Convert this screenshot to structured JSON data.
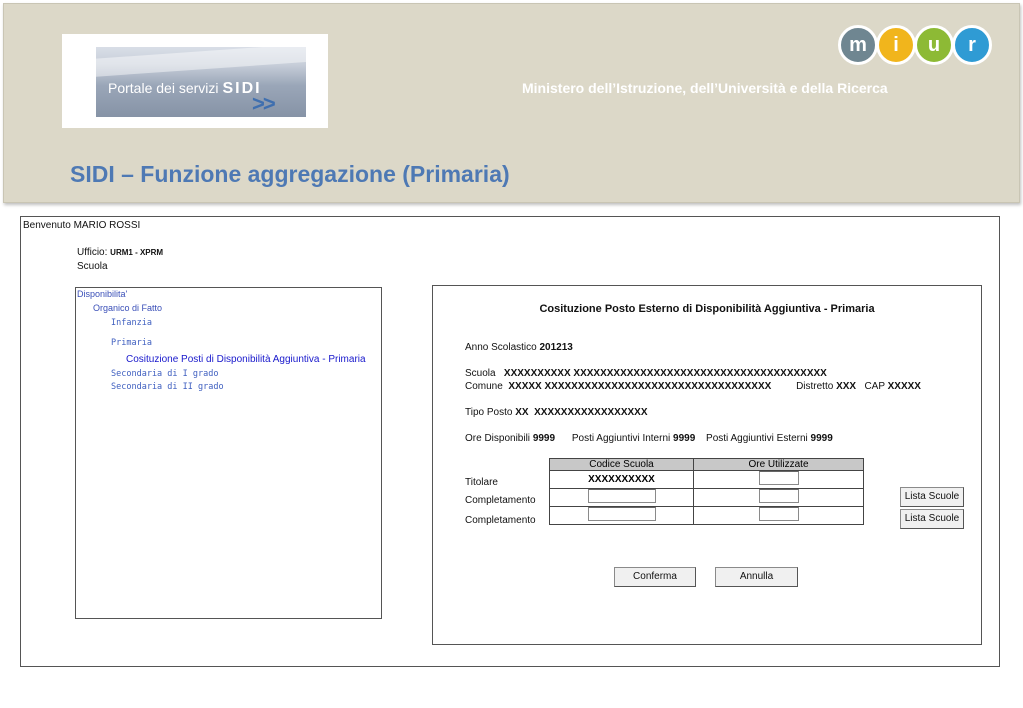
{
  "header": {
    "logo": {
      "text": "Portale dei servizi",
      "brand": "SIDI",
      "arrows": ">>"
    },
    "miur_letters": [
      "m",
      "i",
      "u",
      "r"
    ],
    "miur_colors": [
      "#6f8691",
      "#f1b51c",
      "#8dba35",
      "#2f9bd4"
    ],
    "ministry": "Ministero dell’Istruzione, dell’Università e della Ricerca",
    "title": "SIDI – Funzione aggregazione (Primaria)"
  },
  "user": {
    "welcome": "Benvenuto MARIO ROSSI",
    "ufficio_label": "Ufficio:",
    "ufficio_value": "URM1 - XPRM",
    "scuola_label": "Scuola"
  },
  "tree": {
    "disponibilita": "Disponibilita'",
    "organico": "Organico di Fatto",
    "infanzia": "Infanzia",
    "primaria": "Primaria",
    "costituzione": "Cosituzione Posti di Disponibilità Aggiuntiva - Primaria",
    "sec1": "Secondaria di I grado",
    "sec2": "Secondaria di II grado"
  },
  "panel": {
    "title": "Cosituzione Posto Esterno di Disponibilità Aggiuntiva - Primaria",
    "anno_label": "Anno Scolastico",
    "anno_value": "201213",
    "scuola_label": "Scuola",
    "scuola_value": "XXXXXXXXXX XXXXXXXXXXXXXXXXXXXXXXXXXXXXXXXXXXXXXX",
    "comune_label": "Comune",
    "comune_value": "XXXXX XXXXXXXXXXXXXXXXXXXXXXXXXXXXXXXXXX",
    "distretto_label": "Distretto",
    "distretto_value": "XXX",
    "cap_label": "CAP",
    "cap_value": "XXXXX",
    "tipo_label": "Tipo Posto",
    "tipo_code": "XX",
    "tipo_value": "XXXXXXXXXXXXXXXXX",
    "ore_label": "Ore Disponibili",
    "ore_value": "9999",
    "interni_label": "Posti Aggiuntivi Interni",
    "interni_value": "9999",
    "esterni_label": "Posti Aggiuntivi Esterni",
    "esterni_value": "9999",
    "col_codice": "Codice Scuola",
    "col_ore": "Ore Utilizzate",
    "titolare_label": "Titolare",
    "titolare_code": "XXXXXXXXXX",
    "completamento1_label": "Completamento",
    "completamento2_label": "Completamento",
    "lista1": "Lista Scuole",
    "lista2": "Lista Scuole",
    "conferma": "Conferma",
    "annulla": "Annulla"
  }
}
